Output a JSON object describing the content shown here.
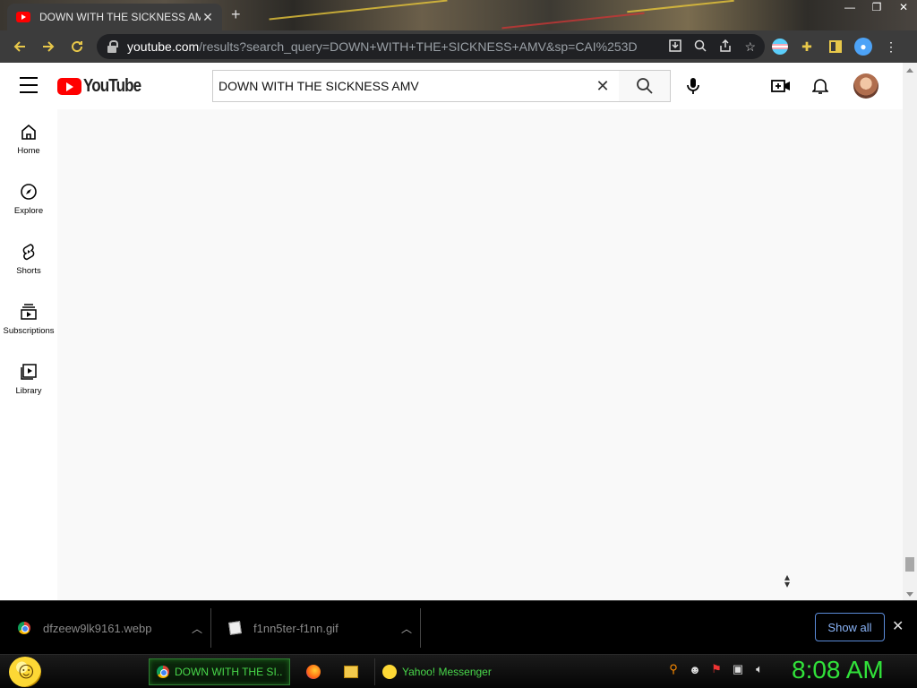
{
  "browser": {
    "tab_title": "DOWN WITH THE SICKNESS AM",
    "url_host": "youtube.com",
    "url_path": "/results?search_query=DOWN+WITH+THE+SICKNESS+AMV&sp=CAI%253D",
    "icons": {
      "back": "back-arrow-icon",
      "forward": "forward-arrow-icon",
      "reload": "reload-icon",
      "download": "download-icon",
      "zoom": "zoom-icon",
      "share": "share-icon",
      "bookmark": "star-icon",
      "extensions": "puzzle-icon",
      "sidepanel": "sidepanel-icon",
      "menu": "more-vert-icon"
    }
  },
  "youtube": {
    "logo_text": "YouTube",
    "search": {
      "value": "DOWN WITH THE SICKNESS AMV"
    },
    "guide": [
      {
        "label": "Home",
        "icon": "home-icon"
      },
      {
        "label": "Explore",
        "icon": "compass-icon"
      },
      {
        "label": "Shorts",
        "icon": "shorts-icon"
      },
      {
        "label": "Subscriptions",
        "icon": "subscriptions-icon"
      },
      {
        "label": "Library",
        "icon": "library-icon"
      }
    ]
  },
  "downloads": {
    "items": [
      {
        "name": "dfzeew9lk9161.webp"
      },
      {
        "name": "f1nn5ter-f1nn.gif"
      }
    ],
    "show_all": "Show all"
  },
  "taskbar": {
    "tasks": [
      {
        "label": "DOWN WITH THE SI..."
      },
      {
        "label": "Yahoo! Messenger"
      }
    ],
    "clock": "8:08 AM"
  },
  "colors": {
    "youtube_red": "#ff0000",
    "taskbar_green": "#31e23a",
    "chrome_dark": "#3c3c3c"
  }
}
